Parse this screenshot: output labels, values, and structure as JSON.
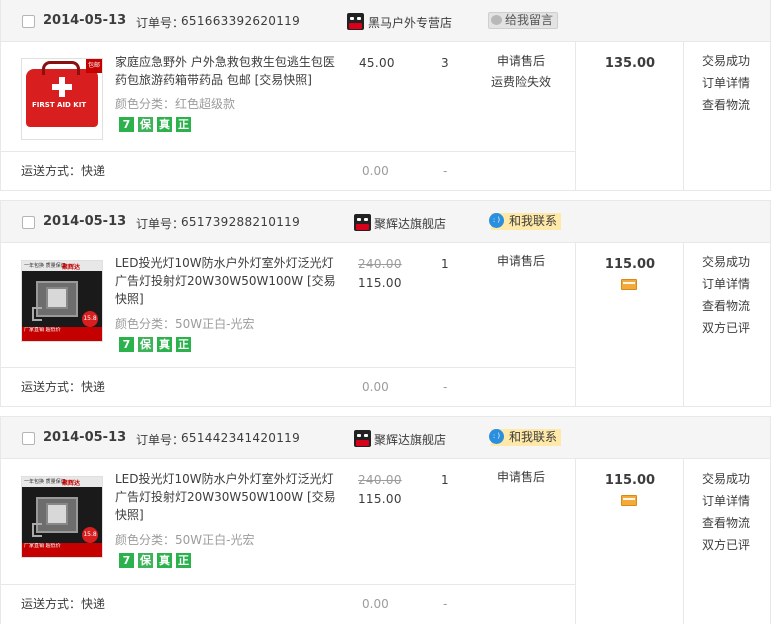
{
  "labels": {
    "order_no": "订单号：",
    "msg_button": "给我留言",
    "chat_button": "和我联系",
    "sku_prefix": "颜色分类：",
    "ship_label": "运送方式：快递",
    "ship_fee": "0.00",
    "ship_dash": "-"
  },
  "badges": [
    "7",
    "保",
    "真",
    "正"
  ],
  "colors": {
    "badge_green": "#2bb24c",
    "chat_yellow": "#ffe9a8",
    "chat_blue": "#2a8fdf",
    "header_bg": "#f5f5f5"
  },
  "orders": [
    {
      "date": "2014-05-13",
      "order_no": "651663392620119",
      "shop": "黑马户外专营店",
      "contact": "msg",
      "item": {
        "title": "家庭应急野外 户外急救包救生包逃生包医药包旅游药箱带药品 包邮 [交易快照]",
        "sku": "红色超级款",
        "image": "first-aid-kit",
        "image_text": "FIRST AID KIT",
        "image_tag": "包邮",
        "price_original": "",
        "price": "45.00",
        "qty": "3",
        "status_lines": [
          "申请售后",
          "运费险失效"
        ]
      },
      "total": "135.00",
      "pay_icon": false,
      "actions": [
        "交易成功",
        "订单详情",
        "查看物流"
      ]
    },
    {
      "date": "2014-05-13",
      "order_no": "651739288210119",
      "shop": "聚辉达旗舰店",
      "contact": "chat",
      "item": {
        "title": "LED投光灯10W防水户外灯室外灯泛光灯广告灯投射灯20W30W50W100W [交易快照]",
        "sku": "50W正白-光宏",
        "image": "led-floodlight",
        "image_top": "一年包换 质量保证",
        "image_brand": "聚辉达",
        "image_price": "15.8",
        "image_bottom": "厂家直销 超低价",
        "price_original": "240.00",
        "price": "115.00",
        "qty": "1",
        "status_lines": [
          "申请售后"
        ]
      },
      "total": "115.00",
      "pay_icon": true,
      "actions": [
        "交易成功",
        "订单详情",
        "查看物流",
        "双方已评"
      ]
    },
    {
      "date": "2014-05-13",
      "order_no": "651442341420119",
      "shop": "聚辉达旗舰店",
      "contact": "chat",
      "item": {
        "title": "LED投光灯10W防水户外灯室外灯泛光灯广告灯投射灯20W30W50W100W [交易快照]",
        "sku": "50W正白-光宏",
        "image": "led-floodlight",
        "image_top": "一年包换 质量保证",
        "image_brand": "聚辉达",
        "image_price": "15.8",
        "image_bottom": "厂家直销 超低价",
        "price_original": "240.00",
        "price": "115.00",
        "qty": "1",
        "status_lines": [
          "申请售后"
        ]
      },
      "total": "115.00",
      "pay_icon": true,
      "actions": [
        "交易成功",
        "订单详情",
        "查看物流",
        "双方已评"
      ]
    }
  ]
}
